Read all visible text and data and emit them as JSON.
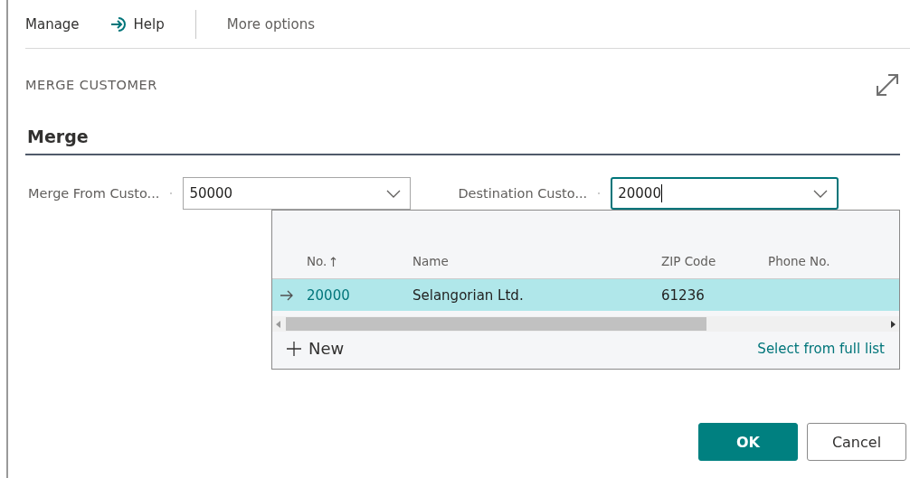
{
  "toolbar": [
    {
      "kind": "text",
      "label": "Manage"
    },
    {
      "kind": "help",
      "label": "Help"
    },
    {
      "kind": "separator"
    },
    {
      "kind": "text",
      "label": "More options"
    }
  ],
  "dialog_title": "MERGE CUSTOMER",
  "section": "Merge",
  "fields": [
    {
      "label": "Merge From Custo...",
      "value": "50000",
      "focused": false
    },
    {
      "label": "Destination Custo...",
      "value": "20000",
      "focused": true
    }
  ],
  "lookup": {
    "columns": [
      {
        "label": "No.",
        "sorted": true
      },
      {
        "label": "Name",
        "sorted": false
      },
      {
        "label": "ZIP Code",
        "sorted": false
      },
      {
        "label": "Phone No.",
        "sorted": false
      }
    ],
    "rows": [
      {
        "cells": [
          "20000",
          "Selangorian Ltd.",
          "61236",
          ""
        ],
        "selected": true
      }
    ],
    "new_label": "New",
    "full_list_link": "Select from full list"
  },
  "buttons": [
    {
      "kind": "primary",
      "label": "OK"
    },
    {
      "kind": "secondary",
      "label": "Cancel"
    }
  ]
}
